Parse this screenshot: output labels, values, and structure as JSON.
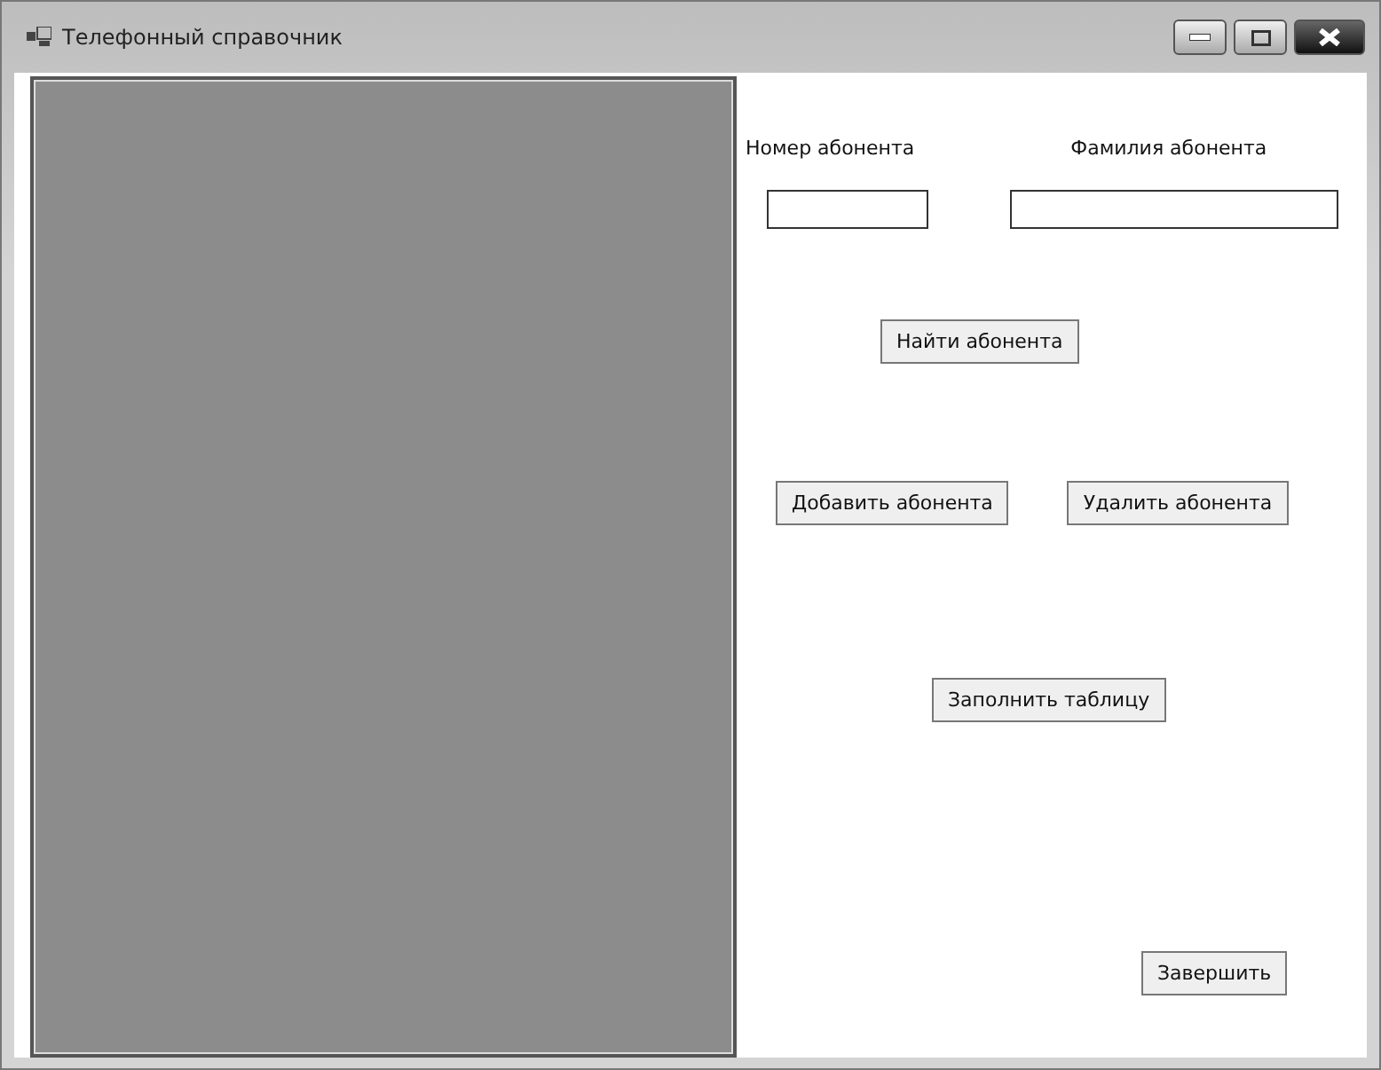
{
  "window": {
    "title": "Телефонный справочник"
  },
  "fields": [
    {
      "label": "Номер абонента"
    },
    {
      "label": "Фамилия абонента"
    }
  ],
  "buttons": {
    "find": "Найти абонента",
    "add": "Добавить абонента",
    "delete": "Удалить абонента",
    "fill": "Заполнить таблицу",
    "finish": "Завершить"
  }
}
